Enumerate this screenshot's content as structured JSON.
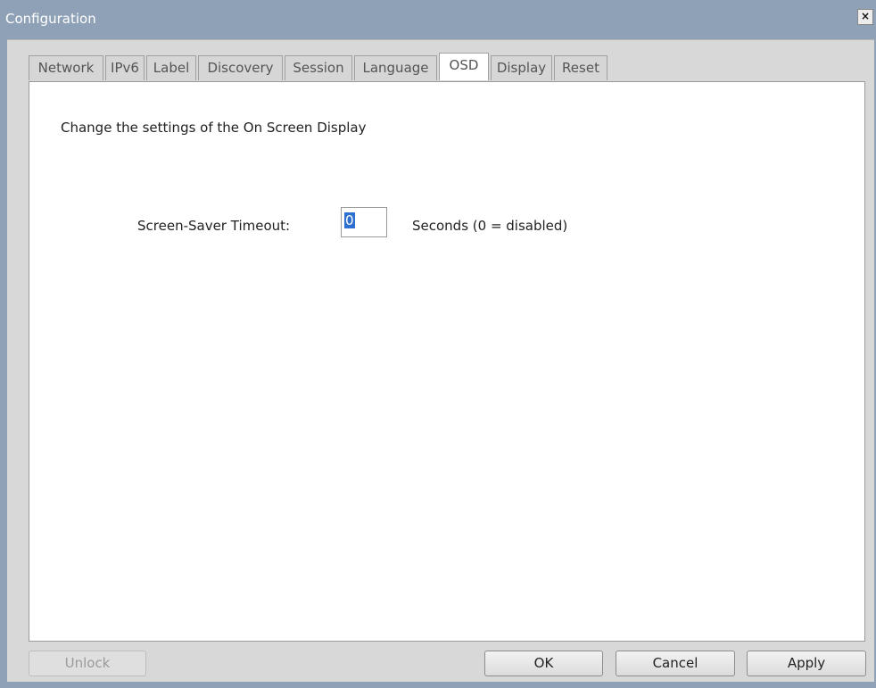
{
  "window": {
    "title": "Configuration",
    "close_glyph": "×"
  },
  "tabs": [
    {
      "label": "Network",
      "active": false
    },
    {
      "label": "IPv6",
      "active": false
    },
    {
      "label": "Label",
      "active": false
    },
    {
      "label": "Discovery",
      "active": false
    },
    {
      "label": "Session",
      "active": false
    },
    {
      "label": "Language",
      "active": false
    },
    {
      "label": "OSD",
      "active": true
    },
    {
      "label": "Display",
      "active": false
    },
    {
      "label": "Reset",
      "active": false
    }
  ],
  "osd": {
    "description": "Change the settings of the On Screen Display",
    "screensaver_label": "Screen-Saver Timeout:",
    "screensaver_value": "0",
    "screensaver_hint": "Seconds (0 = disabled)"
  },
  "buttons": {
    "unlock": "Unlock",
    "ok": "OK",
    "cancel": "Cancel",
    "apply": "Apply"
  },
  "colors": {
    "titlebar": "#8fa1b6",
    "selection": "#2e6fd0"
  }
}
